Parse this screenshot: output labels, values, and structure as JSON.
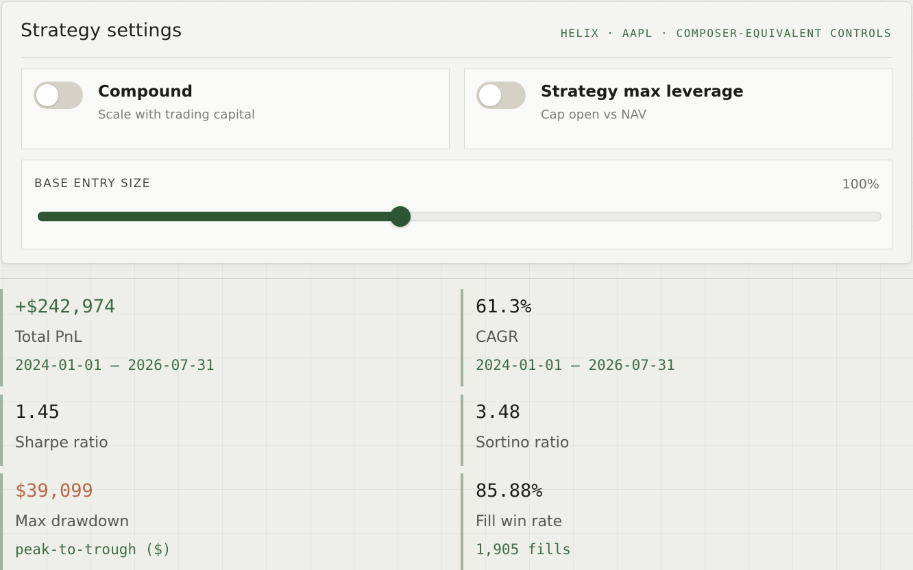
{
  "panel": {
    "title": "Strategy settings",
    "meta": "HELIX · AAPL · COMPOSER-EQUIVALENT CONTROLS"
  },
  "toggles": [
    {
      "title": "Compound",
      "subtitle": "Scale with trading capital",
      "enabled": false
    },
    {
      "title": "Strategy max leverage",
      "subtitle": "Cap open vs NAV",
      "enabled": false
    }
  ],
  "slider": {
    "label": "BASE ENTRY SIZE",
    "value_text": "100%",
    "fill_fraction": 0.43
  },
  "metrics": [
    {
      "value": "+$242,974",
      "label": "Total PnL",
      "sub": "2024-01-01 – 2026-07-31",
      "tone": "positive"
    },
    {
      "value": "61.3%",
      "label": "CAGR",
      "sub": "2024-01-01 – 2026-07-31",
      "tone": "neutral"
    },
    {
      "value": "1.45",
      "label": "Sharpe ratio",
      "sub": "",
      "tone": "neutral"
    },
    {
      "value": "3.48",
      "label": "Sortino ratio",
      "sub": "",
      "tone": "neutral"
    },
    {
      "value": "$39,099",
      "label": "Max drawdown",
      "sub": "peak-to-trough ($)",
      "tone": "negative"
    },
    {
      "value": "85.88%",
      "label": "Fill win rate",
      "sub": "1,905 fills",
      "tone": "neutral"
    }
  ],
  "colors": {
    "accent": "#2f5634",
    "positive": "#3e6b45",
    "negative": "#b4694b",
    "toggle_off": "#d6d1c6"
  }
}
